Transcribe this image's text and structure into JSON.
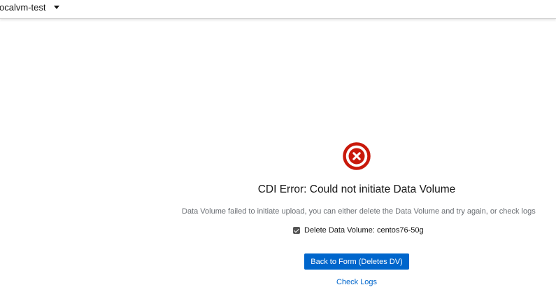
{
  "header": {
    "project_name": "ocalvm-test",
    "dropdown_icon": "caret-down-icon"
  },
  "error": {
    "icon": "times-circle-icon",
    "icon_color": "#c9190b",
    "title": "CDI Error: Could not initiate Data Volume",
    "message": "Data Volume failed to initiate upload, you can either delete the Data Volume and try again, or check logs",
    "checkbox": {
      "checked": true,
      "label": "Delete Data Volume: centos76-50g"
    },
    "primary_button_label": "Back to Form (Deletes DV)",
    "link_label": "Check Logs"
  },
  "colors": {
    "primary": "#0066cc",
    "error": "#c9190b",
    "secondary_text": "#6a6e73"
  }
}
